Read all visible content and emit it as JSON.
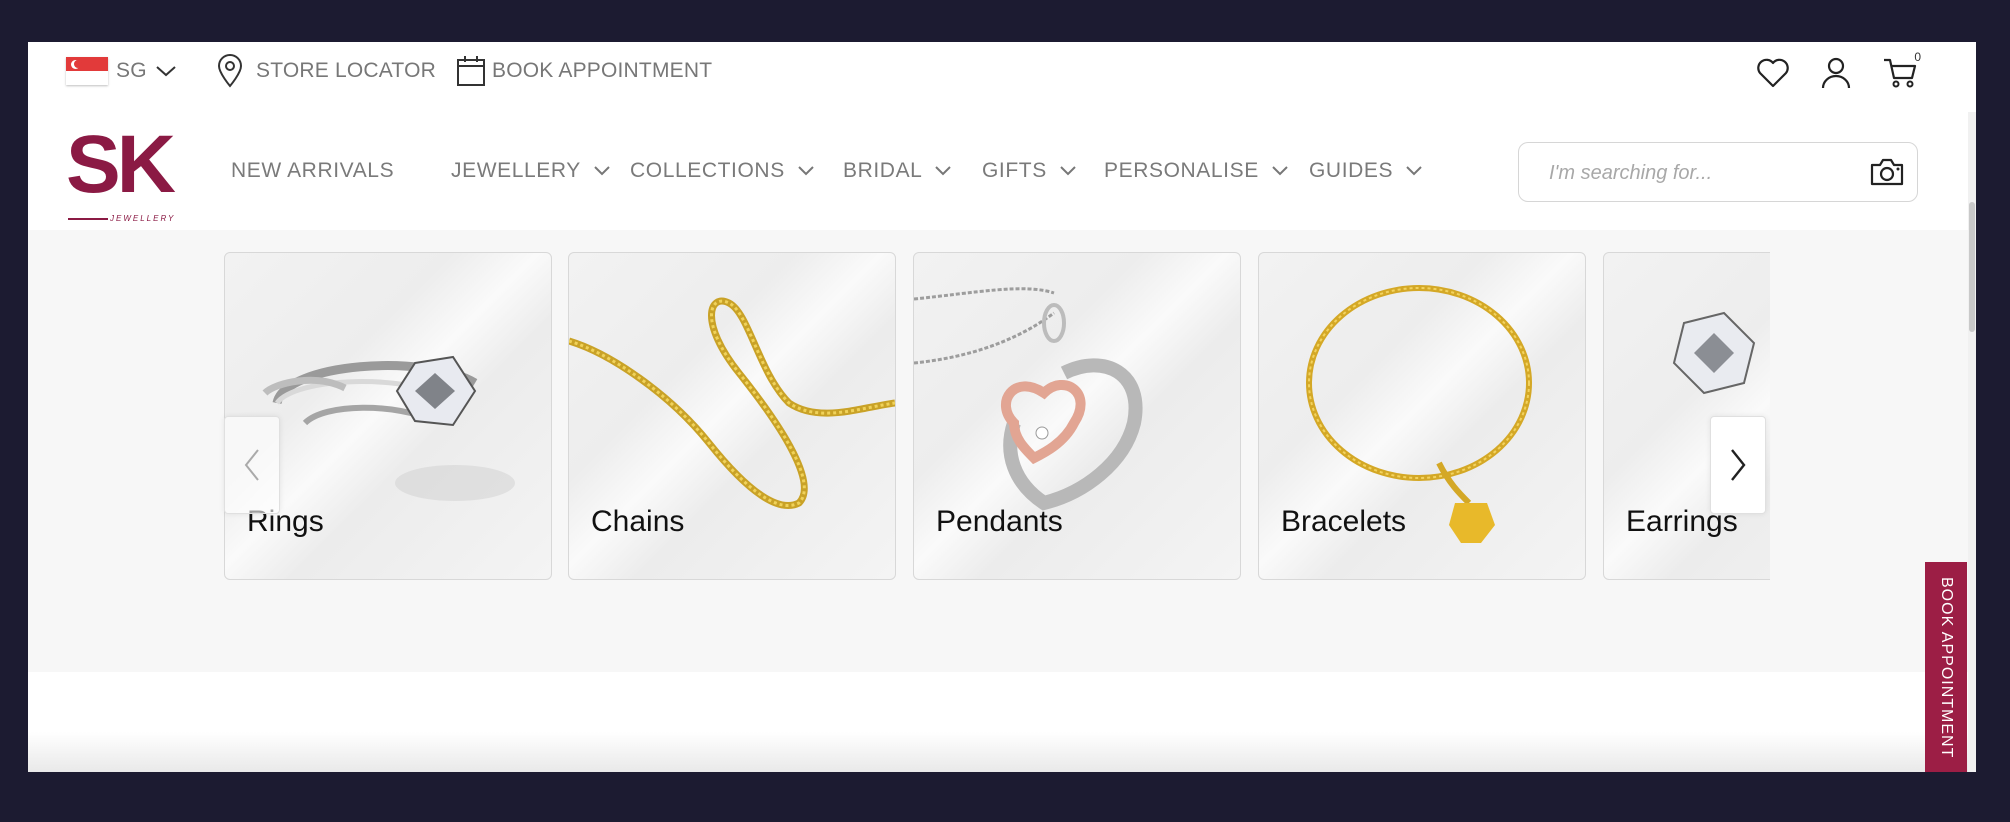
{
  "topbar": {
    "country_code": "SG",
    "store_locator": "STORE LOCATOR",
    "book_appointment": "BOOK APPOINTMENT",
    "cart_count": "0"
  },
  "brand": {
    "logo_text": "SK",
    "logo_subtext": "JEWELLERY",
    "accent_color": "#8b1a44"
  },
  "nav": {
    "items": [
      {
        "label": "NEW ARRIVALS",
        "dropdown": false
      },
      {
        "label": "JEWELLERY",
        "dropdown": true
      },
      {
        "label": "COLLECTIONS",
        "dropdown": true
      },
      {
        "label": "BRIDAL",
        "dropdown": true
      },
      {
        "label": "GIFTS",
        "dropdown": true
      },
      {
        "label": "PERSONALISE",
        "dropdown": true
      },
      {
        "label": "GUIDES",
        "dropdown": true
      }
    ]
  },
  "search": {
    "placeholder": "I'm searching for..."
  },
  "categories": [
    {
      "label": "Rings",
      "image": "ring-image"
    },
    {
      "label": "Chains",
      "image": "chain-image"
    },
    {
      "label": "Pendants",
      "image": "pendant-image"
    },
    {
      "label": "Bracelets",
      "image": "bracelet-image"
    },
    {
      "label": "Earrings",
      "image": "earring-image"
    }
  ],
  "side_tab": {
    "label": "BOOK APPOINTMENT",
    "color": "#9c1e45"
  }
}
